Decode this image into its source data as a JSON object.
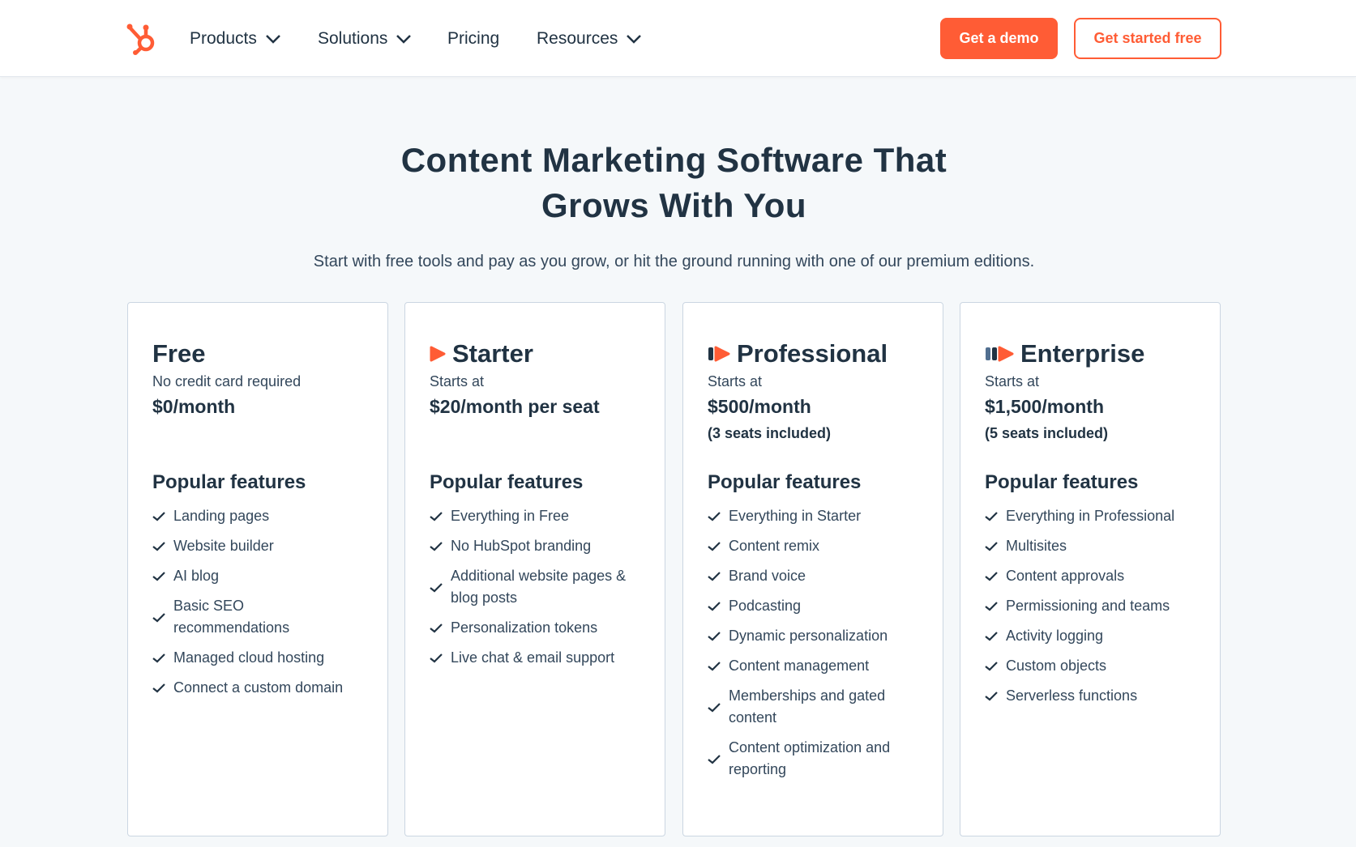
{
  "nav": {
    "products": "Products",
    "solutions": "Solutions",
    "pricing": "Pricing",
    "resources": "Resources",
    "demo_button": "Get a demo",
    "free_button": "Get started free"
  },
  "hero": {
    "title_line1": "Content Marketing Software That",
    "title_line2": "Grows With You",
    "subtitle": "Start with free tools and pay as you grow, or hit the ground running with one of our premium editions."
  },
  "colors": {
    "brand": "#ff5c35",
    "text": "#213343",
    "background": "#f5f8fa"
  },
  "plans": [
    {
      "name": "Free",
      "note": "No credit card required",
      "price": "$0/month",
      "seats": "",
      "features_title": "Popular features",
      "features": [
        "Landing pages",
        "Website builder",
        "AI blog",
        "Basic SEO recommendations",
        "Managed cloud hosting",
        "Connect a custom domain"
      ]
    },
    {
      "name": "Starter",
      "icon": "starter-tier-icon",
      "note": "Starts at",
      "price": "$20/month per seat",
      "seats": "",
      "features_title": "Popular features",
      "features": [
        "Everything in Free",
        "No HubSpot branding",
        "Additional website pages & blog posts",
        "Personalization tokens",
        "Live chat & email support"
      ]
    },
    {
      "name": "Professional",
      "icon": "professional-tier-icon",
      "note": "Starts at",
      "price": "$500/month",
      "seats": "(3 seats included)",
      "features_title": "Popular features",
      "features": [
        "Everything in Starter",
        "Content remix",
        "Brand voice",
        "Podcasting",
        "Dynamic personalization",
        "Content management",
        "Memberships and gated content",
        "Content optimization and reporting"
      ]
    },
    {
      "name": "Enterprise",
      "icon": "enterprise-tier-icon",
      "note": "Starts at",
      "price": "$1,500/month",
      "seats": "(5 seats included)",
      "features_title": "Popular features",
      "features": [
        "Everything in Professional",
        "Multisites",
        "Content approvals",
        "Permissioning and teams",
        "Activity logging",
        "Custom objects",
        "Serverless functions"
      ]
    }
  ]
}
